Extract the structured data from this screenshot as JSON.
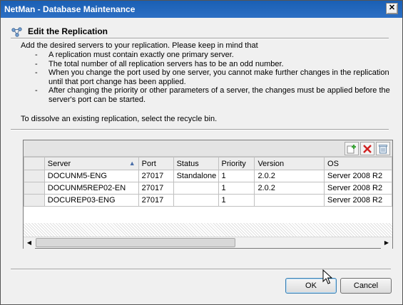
{
  "window": {
    "title": "NetMan - Database Maintenance",
    "close_glyph": "✕"
  },
  "header": {
    "title": "Edit the Replication",
    "icon": "replication-icon"
  },
  "description": {
    "intro": "Add the desired servers to your replication. Please keep in mind that",
    "bullets": [
      "A replication must contain exactly one primary server.",
      "The total number of all replication servers has to be an odd number.",
      "When you change the port used by one server, you cannot make further changes in the replication until that port change has been applied.",
      "After changing the priority or other parameters of a server, the changes must be applied before the server's port can be started."
    ],
    "bullet_dash": "-",
    "dissolve": "To dissolve an existing replication, select the recycle bin."
  },
  "toolbar": {
    "buttons": [
      {
        "name": "add-server-button",
        "icon": "add-icon"
      },
      {
        "name": "remove-server-button",
        "icon": "delete-icon"
      },
      {
        "name": "recycle-bin-button",
        "icon": "recycle-bin-icon"
      }
    ]
  },
  "grid": {
    "columns": [
      "Server",
      "Port",
      "Status",
      "Priority",
      "Version",
      "OS"
    ],
    "sort_column": "Server",
    "sort_glyph": "▲",
    "rows": [
      [
        "DOCUNM5-ENG",
        "27017",
        "Standalone",
        "1",
        "2.0.2",
        "Server 2008 R2"
      ],
      [
        "DOCUNM5REP02-EN",
        "27017",
        "",
        "1",
        "2.0.2",
        "Server 2008 R2"
      ],
      [
        "DOCUREP03-ENG",
        "27017",
        "",
        "1",
        "",
        "Server 2008 R2"
      ]
    ]
  },
  "scrollbar": {
    "left_glyph": "◀",
    "right_glyph": "▶"
  },
  "buttons": {
    "ok": "OK",
    "cancel": "Cancel"
  },
  "colors": {
    "titlebar": "#1a5fb4",
    "add_icon": "#3aa336",
    "delete_icon": "#d02020"
  }
}
